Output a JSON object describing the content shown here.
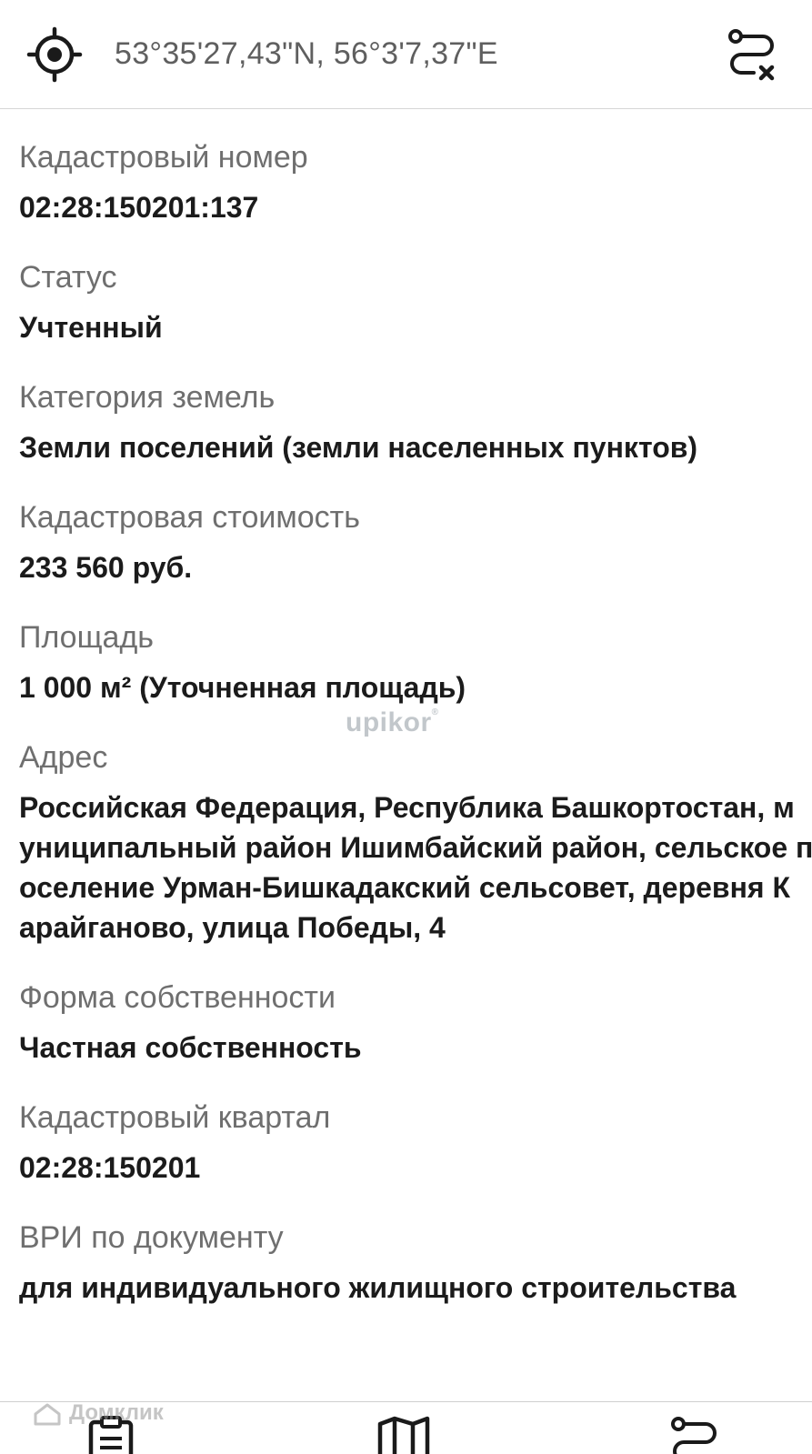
{
  "header": {
    "coordinates": "53°35'27,43\"N, 56°3'7,37\"E",
    "locate_icon": "crosshair-icon",
    "clear_route_icon": "route-clear-icon"
  },
  "fields": [
    {
      "label": "Кадастровый номер",
      "value": "02:28:150201:137"
    },
    {
      "label": "Статус",
      "value": "Учтенный"
    },
    {
      "label": "Категория земель",
      "value": "Земли поселений (земли населенных пунктов)"
    },
    {
      "label": "Кадастровая стоимость",
      "value": "233 560 руб."
    },
    {
      "label": "Площадь",
      "value": "1 000 м² (Уточненная площадь)"
    },
    {
      "label": "Адрес",
      "value_lines": [
        "Российская Федерация, Республика Башкортостан, м",
        "униципальный район Ишимбайский район, сельское п",
        "оселение Урман-Бишкадакский сельсовет, деревня К",
        "арайганово, улица Победы, 4"
      ]
    },
    {
      "label": "Форма собственности",
      "value": "Частная собственность"
    },
    {
      "label": "Кадастровый квартал",
      "value": "02:28:150201"
    },
    {
      "label": "ВРИ по документу",
      "value": "для индивидуального жилищного строительства"
    }
  ],
  "watermark": {
    "text": "upikor",
    "mark": "®"
  },
  "branding": {
    "text": "Домклик"
  },
  "bottom_nav": [
    {
      "name": "documents",
      "icon": "clipboard-icon"
    },
    {
      "name": "map",
      "icon": "map-icon"
    },
    {
      "name": "route",
      "icon": "route-icon"
    }
  ],
  "colors": {
    "text": "#1b1b1b",
    "label": "#6f6f6f",
    "coords": "#5f5f5f",
    "divider": "#d6d6d6"
  }
}
